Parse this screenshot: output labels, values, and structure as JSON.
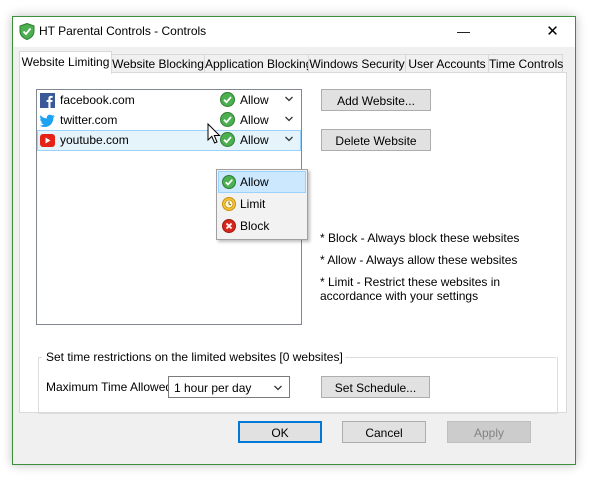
{
  "window": {
    "title": "HT Parental Controls - Controls",
    "minimize_glyph": "—",
    "close_glyph": "✕",
    "icon": "shield-check-icon",
    "accent_color": "#3d8f3d"
  },
  "tabs": [
    {
      "label": "Website Limiting",
      "active": true
    },
    {
      "label": "Website Blocking",
      "active": false
    },
    {
      "label": "Application Blocking",
      "active": false
    },
    {
      "label": "Windows Security",
      "active": false
    },
    {
      "label": "User Accounts",
      "active": false
    },
    {
      "label": "Time Controls",
      "active": false
    }
  ],
  "sites": [
    {
      "name": "facebook.com",
      "icon": "facebook-icon",
      "status": "Allow",
      "selected": false
    },
    {
      "name": "twitter.com",
      "icon": "twitter-icon",
      "status": "Allow",
      "selected": false
    },
    {
      "name": "youtube.com",
      "icon": "youtube-icon",
      "status": "Allow",
      "selected": true
    }
  ],
  "status_dropdown": {
    "options": [
      {
        "label": "Allow",
        "icon": "allow-check-icon",
        "highlighted": true
      },
      {
        "label": "Limit",
        "icon": "limit-clock-icon",
        "highlighted": false
      },
      {
        "label": "Block",
        "icon": "block-x-icon",
        "highlighted": false
      }
    ]
  },
  "buttons": {
    "add_website": "Add Website...",
    "delete_website": "Delete Website",
    "set_schedule": "Set Schedule...",
    "ok": "OK",
    "cancel": "Cancel",
    "apply": "Apply"
  },
  "notes": {
    "block": "* Block - Always block these websites",
    "allow": "* Allow - Always allow these websites",
    "limit": "* Limit - Restrict these websites in accordance with your settings"
  },
  "time_restrictions": {
    "caption": "Set time restrictions on the limited websites [0 websites]",
    "max_time_label": "Maximum Time Allowed",
    "max_time_value": "1 hour per day"
  }
}
